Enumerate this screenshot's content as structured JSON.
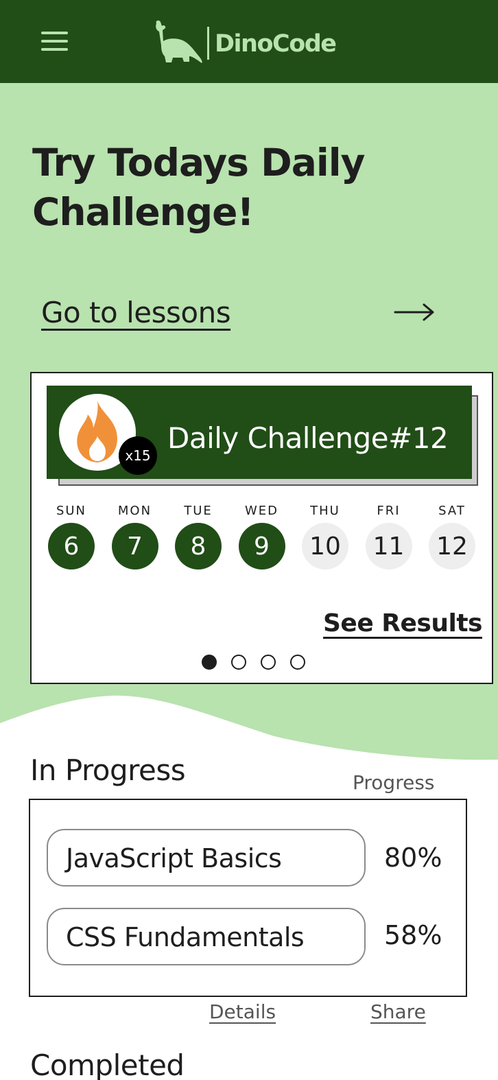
{
  "header": {
    "brand": "DinoCode",
    "menu_icon": "hamburger-menu-icon",
    "logo_icon": "dinosaur-icon",
    "colors": {
      "bar": "#214d17",
      "logo": "#b8e2ae"
    }
  },
  "hero": {
    "title": "Try Todays Daily Challenge!",
    "lessons_link": "Go to lessons",
    "arrow_icon": "arrow-right-icon",
    "background": "#b8e2ae"
  },
  "challenge": {
    "title": "Daily Challenge#12",
    "streak": "x15",
    "streak_icon": "flame-icon",
    "days": [
      {
        "name": "SUN",
        "number": "6",
        "completed": true
      },
      {
        "name": "MON",
        "number": "7",
        "completed": true
      },
      {
        "name": "TUE",
        "number": "8",
        "completed": true
      },
      {
        "name": "WED",
        "number": "9",
        "completed": true
      },
      {
        "name": "THU",
        "number": "10",
        "completed": false
      },
      {
        "name": "FRI",
        "number": "11",
        "completed": false
      },
      {
        "name": "SAT",
        "number": "12",
        "completed": false
      }
    ],
    "see_results": "See Results",
    "pager": {
      "total": 4,
      "active": 1
    }
  },
  "in_progress": {
    "title": "In Progress",
    "column_header": "Progress",
    "courses": [
      {
        "name": "JavaScript Basics",
        "progress": "80%"
      },
      {
        "name": "CSS Fundamentals",
        "progress": "58%"
      }
    ],
    "details_link": "Details",
    "share_link": "Share"
  },
  "completed": {
    "title": "Completed"
  }
}
